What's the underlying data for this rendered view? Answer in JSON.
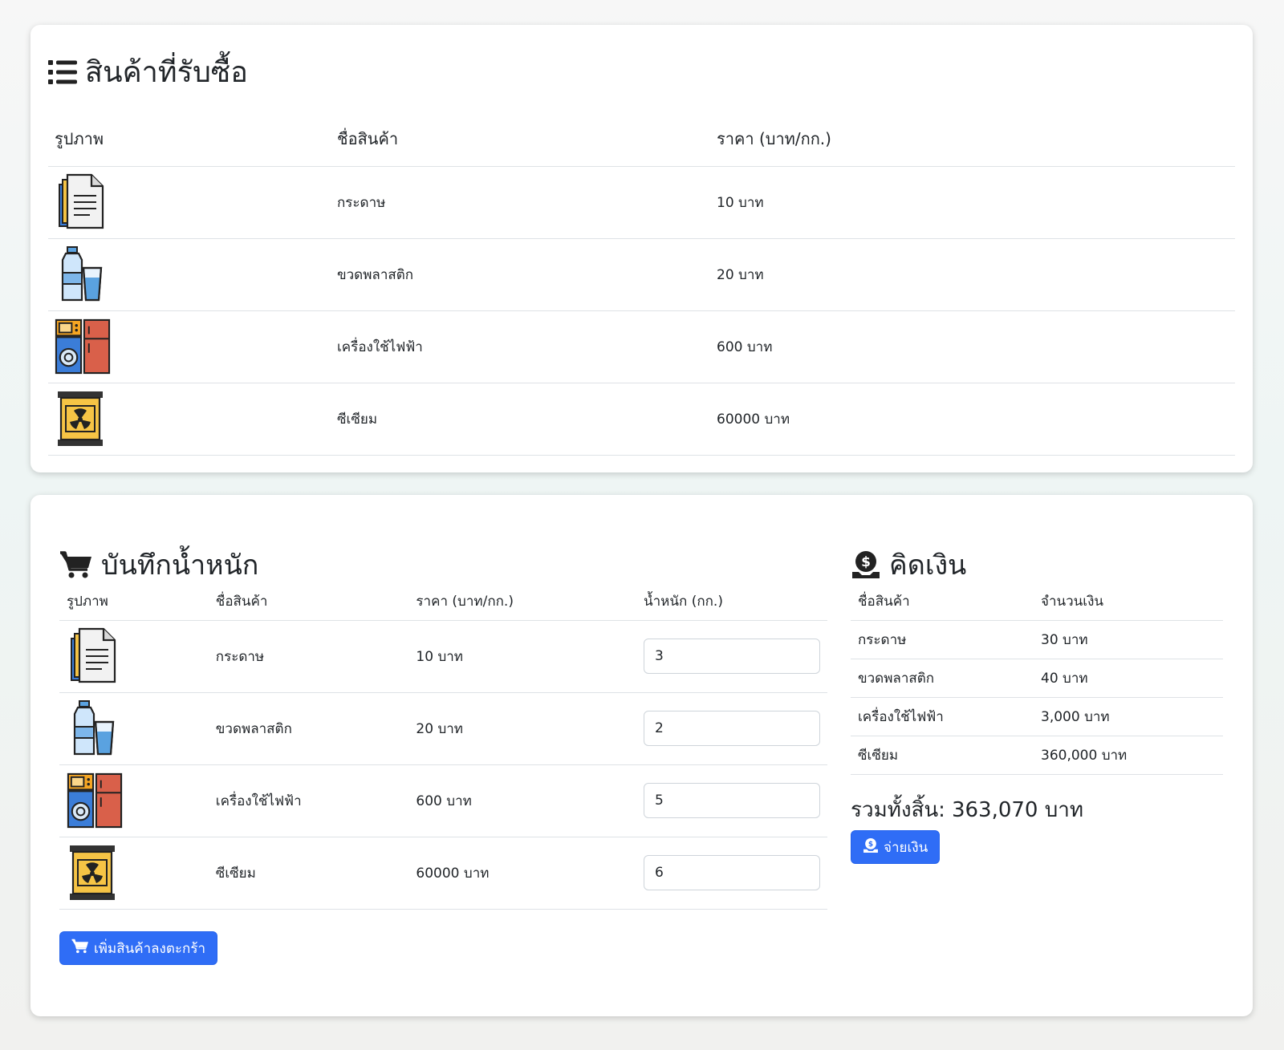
{
  "catalog": {
    "title": "สินค้าที่รับซื้อ",
    "headers": {
      "image": "รูปภาพ",
      "name": "ชื่อสินค้า",
      "price": "ราคา (บาท/กก.)"
    },
    "items": [
      {
        "icon": "paper-icon",
        "name": "กระดาษ",
        "price": "10 บาท"
      },
      {
        "icon": "plastic-bottle-icon",
        "name": "ขวดพลาสติก",
        "price": "20 บาท"
      },
      {
        "icon": "appliances-icon",
        "name": "เครื่องใช้ไฟฟ้า",
        "price": "600 บาท"
      },
      {
        "icon": "radioactive-barrel-icon",
        "name": "ซีเซียม",
        "price": "60000 บาท"
      }
    ]
  },
  "record": {
    "title": "บันทึกน้ำหนัก",
    "headers": {
      "image": "รูปภาพ",
      "name": "ชื่อสินค้า",
      "price": "ราคา (บาท/กก.)",
      "weight": "น้ำหนัก (กก.)"
    },
    "items": [
      {
        "icon": "paper-icon",
        "name": "กระดาษ",
        "price": "10 บาท",
        "weight": "3"
      },
      {
        "icon": "plastic-bottle-icon",
        "name": "ขวดพลาสติก",
        "price": "20 บาท",
        "weight": "2"
      },
      {
        "icon": "appliances-icon",
        "name": "เครื่องใช้ไฟฟ้า",
        "price": "600 บาท",
        "weight": "5"
      },
      {
        "icon": "radioactive-barrel-icon",
        "name": "ซีเซียม",
        "price": "60000 บาท",
        "weight": "6"
      }
    ],
    "add_button_label": "เพิ่มสินค้าลงตะกร้า"
  },
  "checkout": {
    "title": "คิดเงิน",
    "headers": {
      "name": "ชื่อสินค้า",
      "amount": "จำนวนเงิน"
    },
    "items": [
      {
        "name": "กระดาษ",
        "amount": "30 บาท"
      },
      {
        "name": "ขวดพลาสติก",
        "amount": "40 บาท"
      },
      {
        "name": "เครื่องใช้ไฟฟ้า",
        "amount": "3,000 บาท"
      },
      {
        "name": "ซีเซียม",
        "amount": "360,000 บาท"
      }
    ],
    "total_label": "รวมทั้งสิ้น:",
    "total_value": "363,070 บาท",
    "pay_button_label": "จ่ายเงิน"
  },
  "colors": {
    "primary": "#2f6df6",
    "text": "#212529",
    "border": "#dee2e6"
  }
}
